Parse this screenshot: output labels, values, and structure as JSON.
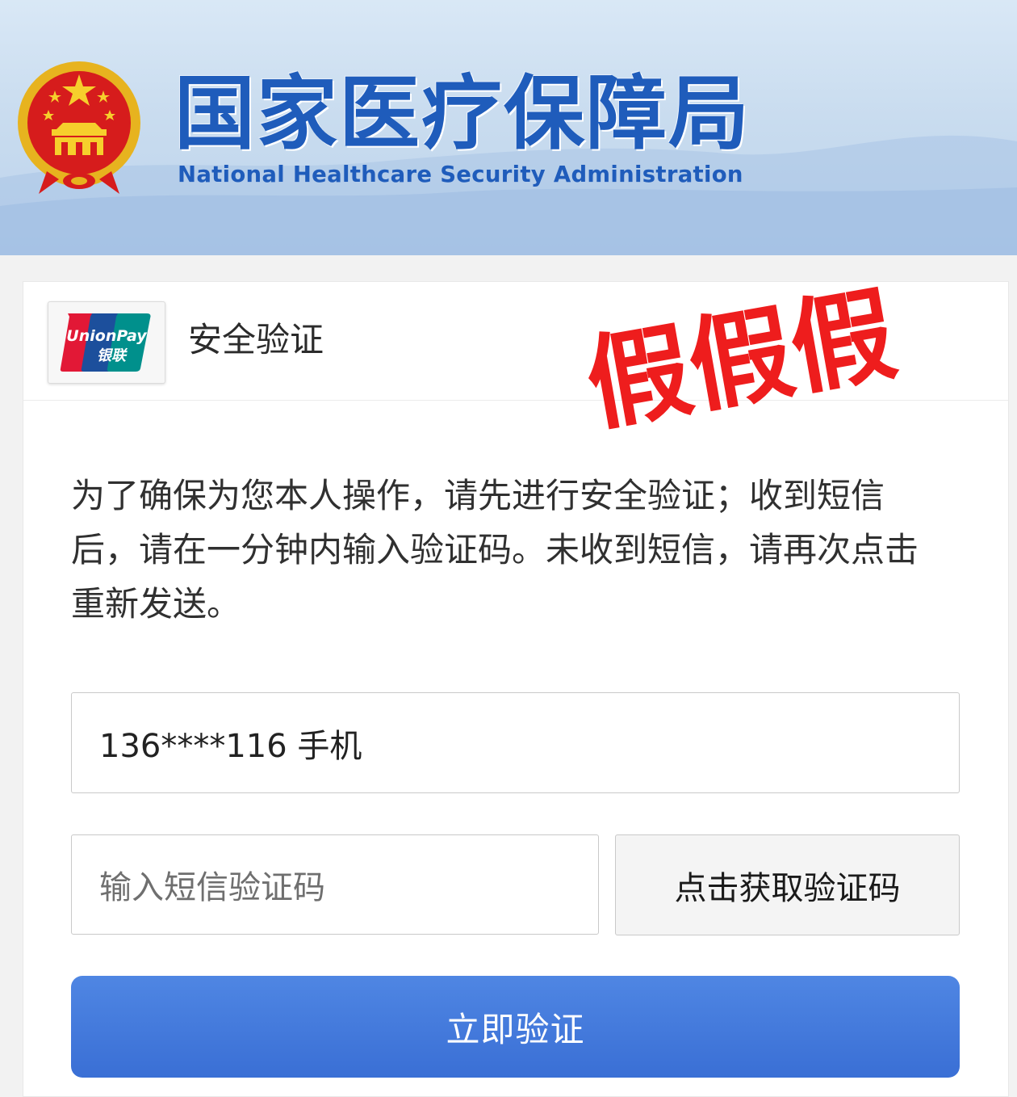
{
  "header": {
    "title_cn": "国家医疗保障局",
    "title_en": "National Healthcare Security Administration",
    "emblem_icon": "national-emblem-icon",
    "brand_color": "#1f5cbb"
  },
  "card": {
    "logo_icon": "unionpay-logo-icon",
    "logo_text_en": "UnionPay",
    "logo_text_cn": "银联",
    "title": "安全验证",
    "fake_stamp": "假假假",
    "instructions": "为了确保为您本人操作，请先进行安全验证；收到短信后，请在一分钟内输入验证码。未收到短信，请再次点击重新发送。",
    "phone_value": "136****116 手机",
    "code_placeholder": "输入短信验证码",
    "get_code_label": "点击获取验证码",
    "verify_label": "立即验证",
    "accent_color": "#3a6fd5",
    "stamp_color": "#ee1414"
  }
}
